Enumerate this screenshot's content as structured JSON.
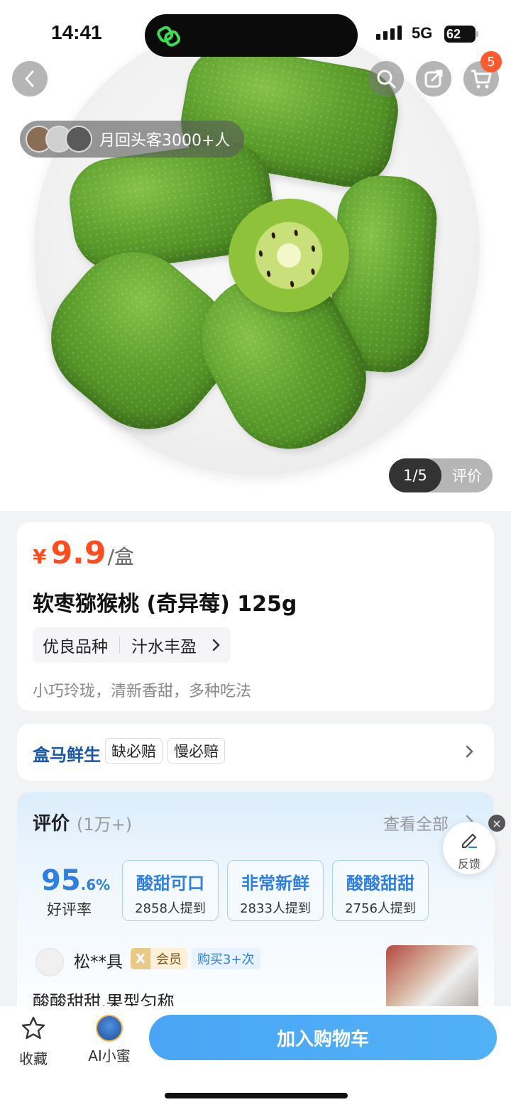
{
  "status_bar": {
    "time": "14:41",
    "network": "5G",
    "battery": "62"
  },
  "header": {
    "cart_count": "5"
  },
  "gallery": {
    "rebuy_text": "月回头客3000+人",
    "counter": "1/5",
    "review_label": "评价"
  },
  "product": {
    "currency": "¥",
    "price": "9.9",
    "unit": "/盒",
    "title": "软枣猕猴桃 (奇异莓) 125g",
    "tags": [
      "优良品种",
      "汁水丰盈"
    ],
    "subtitle": "小巧玲珑，清新香甜，多种吃法"
  },
  "service": {
    "brand": "盒马鲜生",
    "badges": [
      "缺必赔",
      "慢必赔"
    ]
  },
  "reviews": {
    "title": "评价",
    "count": "(1万+)",
    "see_all": "查看全部",
    "rate_main": "95",
    "rate_dec": ".6%",
    "rate_label": "好评率",
    "tags": [
      {
        "keyword": "酸甜可口",
        "count": "2858人提到"
      },
      {
        "keyword": "非常新鲜",
        "count": "2833人提到"
      },
      {
        "keyword": "酸酸甜甜",
        "count": "2756人提到"
      }
    ],
    "first": {
      "user": "松**具",
      "vip": "会员",
      "purchase": "购买3+次",
      "text": "酸酸甜甜,果型匀称"
    }
  },
  "feedback": {
    "label": "反馈"
  },
  "bottom_bar": {
    "favorite": "收藏",
    "ai": "AI小蜜",
    "add_to_cart": "加入购物车"
  },
  "colors": {
    "price": "#ff4d1f",
    "accent_blue": "#2f7fe0",
    "cart_button": "#4aa6f5",
    "brand": "#1756a8"
  }
}
